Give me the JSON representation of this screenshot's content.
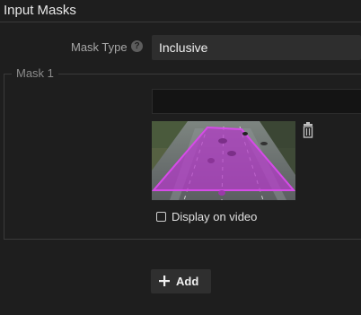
{
  "header": {
    "title": "Input Masks"
  },
  "mask_type": {
    "label": "Mask Type",
    "help_icon": "help-circle-icon",
    "value": "Inclusive"
  },
  "mask": {
    "legend": "Mask 1",
    "name_value": "",
    "preview_icon": "video-preview-with-polygon-mask",
    "mask_color": "#c23fd6",
    "delete_icon": "trash-icon",
    "display_checkbox": {
      "label": "Display on video",
      "checked": false
    }
  },
  "add_button": {
    "icon": "plus-icon",
    "label": "Add"
  }
}
